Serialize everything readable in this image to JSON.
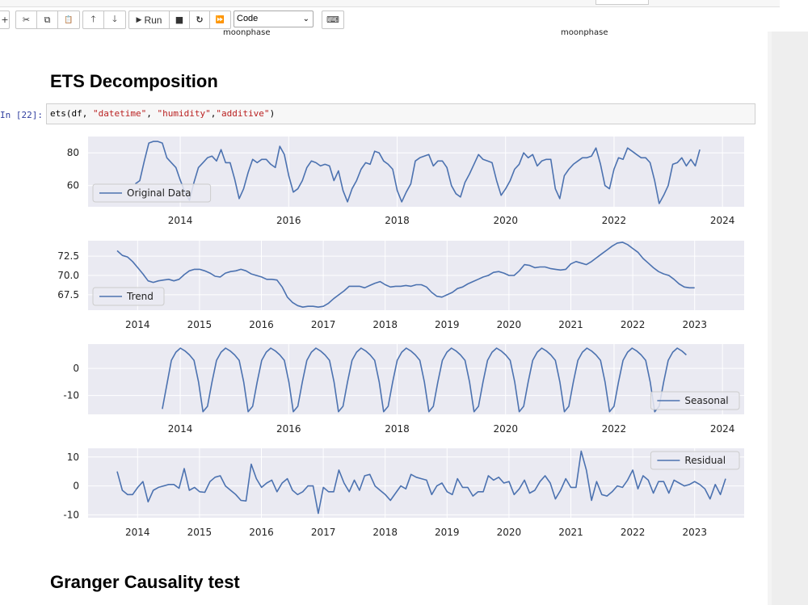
{
  "toolbar": {
    "buttons": [
      {
        "name": "add-cell-button",
        "glyph": "+"
      },
      {
        "name": "cut-button",
        "glyph": "✂"
      },
      {
        "name": "copy-button",
        "glyph": "⧉"
      },
      {
        "name": "paste-button",
        "glyph": "📋"
      },
      {
        "name": "move-up-button",
        "glyph": "🡑"
      },
      {
        "name": "move-down-button",
        "glyph": "🡓"
      },
      {
        "name": "run-button",
        "glyph": "▶",
        "label": "Run"
      },
      {
        "name": "stop-button",
        "glyph": "■"
      },
      {
        "name": "restart-button",
        "glyph": "↻"
      },
      {
        "name": "fast-forward-button",
        "glyph": "⏩"
      },
      {
        "name": "keyboard-button",
        "glyph": "⌨"
      }
    ],
    "run_label": "Run",
    "cell_type": "Code"
  },
  "prev_output": {
    "caption_left": "moonphase",
    "caption_right": "moonphase"
  },
  "headings": {
    "ets": "ETS Decomposition",
    "granger": "Granger Causality test"
  },
  "cell": {
    "prompt": "In [22]:",
    "code_pre": "ets(df, ",
    "s1": "\"datetime\"",
    "sep1": ", ",
    "s2": "\"humidity\"",
    "sep2": ",",
    "s3": "\"additive\"",
    "code_post": ")"
  },
  "colors": {
    "line": "#4c72b0",
    "panel_bg": "#eaeaf2",
    "grid": "#ffffff"
  },
  "chart_data": [
    {
      "type": "line",
      "legend": "Original Data",
      "legend_loc": "lower-left",
      "x_start": 2013.17,
      "x_step": 0.0833,
      "xlim": [
        2012.3,
        2024.4
      ],
      "ylim": [
        47,
        90
      ],
      "xticks": [
        2014,
        2016,
        2018,
        2020,
        2022,
        2024
      ],
      "yticks": [
        60,
        80
      ],
      "values": [
        61,
        63,
        75,
        86,
        87,
        87,
        86,
        77,
        74,
        71,
        63,
        56,
        51,
        62,
        71,
        74,
        77,
        78,
        75,
        82,
        74,
        74,
        64,
        52,
        58,
        68,
        76,
        74,
        76,
        76,
        73,
        71,
        84,
        79,
        66,
        56,
        58,
        63,
        71,
        75,
        74,
        72,
        73,
        72,
        63,
        69,
        57,
        50,
        58,
        63,
        70,
        74,
        73,
        81,
        80,
        75,
        73,
        70,
        57,
        50,
        56,
        61,
        75,
        77,
        78,
        79,
        72,
        75,
        75,
        71,
        60,
        55,
        53,
        62,
        67,
        73,
        79,
        76,
        75,
        74,
        63,
        54,
        58,
        63,
        70,
        73,
        80,
        77,
        79,
        72,
        75,
        76,
        76,
        58,
        52,
        66,
        70,
        73,
        75,
        77,
        77,
        78,
        83,
        73,
        60,
        58,
        70,
        77,
        76,
        83,
        81,
        79,
        77,
        77,
        74,
        63,
        49,
        54,
        60,
        73,
        74,
        77,
        72,
        76,
        72,
        82
      ]
    },
    {
      "type": "line",
      "legend": "Trend",
      "legend_loc": "lower-left",
      "x_start": 2013.67,
      "x_step": 0.0833,
      "xlim": [
        2013.2,
        2023.8
      ],
      "ylim": [
        65.5,
        74.5
      ],
      "xticks": [
        2014,
        2015,
        2016,
        2017,
        2018,
        2019,
        2020,
        2021,
        2022,
        2023
      ],
      "yticks": [
        67.5,
        70.0,
        72.5
      ],
      "values": [
        73.2,
        72.6,
        72.4,
        71.8,
        71.0,
        70.2,
        69.3,
        69.1,
        69.3,
        69.4,
        69.5,
        69.3,
        69.5,
        70.1,
        70.6,
        70.8,
        70.8,
        70.6,
        70.3,
        69.9,
        69.8,
        70.3,
        70.5,
        70.6,
        70.8,
        70.6,
        70.2,
        70.0,
        69.8,
        69.5,
        69.5,
        69.4,
        68.5,
        67.2,
        66.5,
        66.1,
        65.9,
        66.0,
        66.0,
        65.9,
        66.0,
        66.4,
        67.0,
        67.5,
        68.0,
        68.6,
        68.6,
        68.6,
        68.4,
        68.7,
        69.0,
        69.2,
        68.8,
        68.5,
        68.6,
        68.6,
        68.7,
        68.6,
        68.8,
        68.8,
        68.5,
        67.8,
        67.3,
        67.2,
        67.5,
        67.8,
        68.3,
        68.5,
        68.9,
        69.2,
        69.5,
        69.8,
        70.0,
        70.4,
        70.5,
        70.3,
        70.0,
        70.0,
        70.6,
        71.4,
        71.3,
        71.0,
        71.1,
        71.1,
        70.9,
        70.8,
        70.7,
        70.8,
        71.5,
        71.8,
        71.6,
        71.4,
        71.8,
        72.3,
        72.8,
        73.3,
        73.8,
        74.2,
        74.3,
        74.0,
        73.5,
        73.0,
        72.2,
        71.6,
        71.0,
        70.5,
        70.2,
        70.0,
        69.5,
        68.9,
        68.5,
        68.4,
        68.4
      ]
    },
    {
      "type": "line",
      "legend": "Seasonal",
      "legend_loc": "lower-right",
      "x_start": 2013.67,
      "x_step": 0.0833,
      "xlim": [
        2012.3,
        2024.4
      ],
      "ylim": [
        -17,
        9
      ],
      "xticks": [
        2014,
        2016,
        2018,
        2020,
        2022,
        2024
      ],
      "yticks": [
        0,
        -10
      ],
      "values": [
        -15,
        -6,
        3,
        6,
        7.5,
        6.5,
        5,
        3,
        -5,
        -16,
        -14,
        -5,
        3,
        6,
        7.5,
        6.5,
        5,
        3,
        -5,
        -16,
        -14,
        -5,
        3,
        6,
        7.5,
        6.5,
        5,
        3,
        -5,
        -16,
        -14,
        -5,
        3,
        6,
        7.5,
        6.5,
        5,
        3,
        -5,
        -16,
        -14,
        -5,
        3,
        6,
        7.5,
        6.5,
        5,
        3,
        -5,
        -16,
        -14,
        -5,
        3,
        6,
        7.5,
        6.5,
        5,
        3,
        -5,
        -16,
        -14,
        -5,
        3,
        6,
        7.5,
        6.5,
        5,
        3,
        -5,
        -16,
        -14,
        -5,
        3,
        6,
        7.5,
        6.5,
        5,
        3,
        -5,
        -16,
        -14,
        -5,
        3,
        6,
        7.5,
        6.5,
        5,
        3,
        -5,
        -16,
        -14,
        -5,
        3,
        6,
        7.5,
        6.5,
        5,
        3,
        -5,
        -16,
        -14,
        -5,
        3,
        6,
        7.5,
        6.5,
        5,
        3,
        -5,
        -16,
        -14,
        -5,
        3,
        6,
        7.5,
        6.5,
        5
      ]
    },
    {
      "type": "line",
      "legend": "Residual",
      "legend_loc": "top-right",
      "x_start": 2013.67,
      "x_step": 0.0833,
      "xlim": [
        2013.2,
        2023.8
      ],
      "ylim": [
        -11,
        13
      ],
      "xticks": [
        2014,
        2015,
        2016,
        2017,
        2018,
        2019,
        2020,
        2021,
        2022,
        2023
      ],
      "yticks": [
        10,
        0,
        -10
      ],
      "values": [
        5,
        -1.5,
        -3,
        -3,
        -0.5,
        1.5,
        -5.5,
        -1.5,
        -0.5,
        0,
        0.5,
        0.5,
        -0.8,
        6,
        -1.5,
        -0.5,
        -2,
        -2.2,
        1.5,
        3,
        3.5,
        0,
        -1.5,
        -3,
        -5,
        -5.2,
        7.5,
        2.5,
        -0.5,
        1,
        2,
        -2,
        1,
        2.5,
        -1.5,
        -3,
        -2,
        0,
        0,
        -9.5,
        -0.5,
        -2,
        -2,
        5.5,
        1,
        -2,
        2,
        -1.5,
        3.5,
        4,
        0,
        -1.5,
        -3,
        -5,
        -2.5,
        0,
        -1,
        4,
        3,
        2.5,
        2,
        -3,
        0,
        1,
        -2,
        -3,
        2.5,
        -0.5,
        -0.5,
        -3.5,
        -2,
        -2,
        3.5,
        2,
        3,
        1,
        1.5,
        -3,
        -1,
        2,
        -2.5,
        -1.5,
        1.5,
        3.5,
        1,
        -4.5,
        -1.5,
        2.5,
        -0.5,
        -0.5,
        12,
        5.5,
        -5,
        1.5,
        -3,
        -3.5,
        -2,
        0,
        -0.5,
        2,
        5.5,
        -1,
        3.5,
        2,
        -2.5,
        1.5,
        1.5,
        -2.5,
        2,
        1,
        0,
        0.5,
        1.5,
        0.5,
        -1,
        -4.5,
        0.5,
        -3,
        2.5
      ]
    }
  ]
}
